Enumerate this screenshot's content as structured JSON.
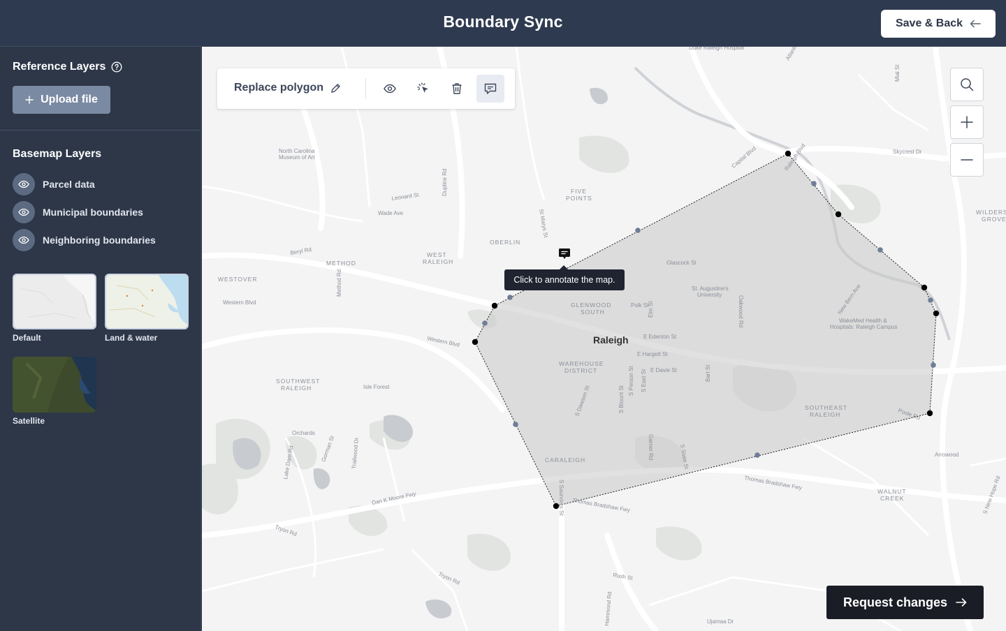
{
  "app": {
    "title": "Boundary Sync",
    "save_back_label": "Save & Back"
  },
  "sidebar": {
    "reference_title": "Reference Layers",
    "upload_label": "Upload file",
    "basemap_title": "Basemap Layers",
    "layers": [
      {
        "label": "Parcel data"
      },
      {
        "label": "Municipal boundaries"
      },
      {
        "label": "Neighboring boundaries"
      }
    ],
    "basemaps": [
      {
        "label": "Default"
      },
      {
        "label": "Land & water"
      },
      {
        "label": "Satellite"
      }
    ]
  },
  "toolbar": {
    "title": "Replace polygon",
    "icons": [
      "pencil-icon",
      "eye-icon",
      "select-pointer-icon",
      "trash-icon",
      "comment-icon"
    ]
  },
  "map": {
    "tooltip": "Click to annotate the map.",
    "city_label": "Raleigh",
    "labels": [
      "Duke Raleigh Hospital",
      "Atlantic Ave",
      "Capital Blvd",
      "Skycrest Dr",
      "Raleigh Blvd",
      "North Carolina Museum of Art",
      "Leonard St",
      "Dupline Rd",
      "FIVE POINTS",
      "Wade Ave",
      "St Marys St",
      "OBERLIN",
      "WILDERS GROVE",
      "Beryl Rd",
      "WEST RALEIGH",
      "METHOD",
      "WESTOVER",
      "Western Blvd",
      "Method Rd",
      "GLENWOOD SOUTH",
      "Glascock St",
      "St. Augustine's University",
      "Polk St",
      "Elm St",
      "Oakwood Rd",
      "New Bern Ave",
      "WakeMed Health & Hospitals: Raleigh Campus",
      "E Edenton St",
      "E Hargett St",
      "E Davie St",
      "WAREHOUSE DISTRICT",
      "SOUTHWEST RALEIGH",
      "Isle Forest",
      "S Dawson St",
      "S Blount St",
      "S Person St",
      "S East St",
      "Bart St",
      "SOUTHEAST RALEIGH",
      "Poole Rd",
      "Orchards",
      "Gorman St",
      "Trailwood Dr",
      "Lake Dam Rd",
      "Garner Rd",
      "S State St",
      "CARALEIGH",
      "Arrowood",
      "Thomas Bradshaw Fwy",
      "WALNUT CREEK",
      "Dan K Moore Fwy",
      "S Saunders St",
      "Tryon Rd",
      "Rush St",
      "Hammond Rd",
      "Ujamaa Dr",
      "S New Hope Rd",
      "Mial St"
    ],
    "zoom_controls": [
      "search-icon",
      "plus-icon",
      "minus-icon"
    ]
  },
  "actions": {
    "request_changes_label": "Request changes"
  },
  "colors": {
    "header_bg": "#2e3a4f",
    "sidebar_bg": "#2d3748",
    "polygon_fill": "#d0d0d0",
    "request_bg": "#1a1d25"
  }
}
